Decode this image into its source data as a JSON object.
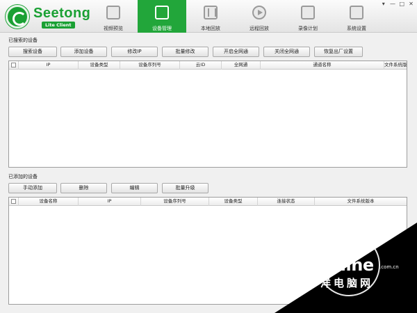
{
  "app": {
    "brand": "Seetong",
    "badge": "Lite Client",
    "window_controls": [
      "▾",
      "—",
      "□",
      "✕"
    ]
  },
  "nav": {
    "tabs": [
      {
        "label": "视频预览",
        "icon": "monitor-icon"
      },
      {
        "label": "设备管理",
        "icon": "device-monitor-icon",
        "active": true
      },
      {
        "label": "本地回放",
        "icon": "film-icon"
      },
      {
        "label": "远程回放",
        "icon": "play-circle-icon"
      },
      {
        "label": "录像计划",
        "icon": "schedule-icon"
      },
      {
        "label": "系统设置",
        "icon": "settings-screen-icon"
      }
    ]
  },
  "searched": {
    "title": "已搜索的设备",
    "buttons": [
      "搜索设备",
      "添加设备",
      "修改IP",
      "批量修改",
      "开启全网通",
      "关闭全网通",
      "恢复出厂设置"
    ],
    "columns": [
      "IP",
      "设备类型",
      "设备序列号",
      "云ID",
      "全网通",
      "通道名称",
      "文件系统版本"
    ],
    "rows": []
  },
  "added": {
    "title": "已添加的设备",
    "buttons": [
      "手动添加",
      "删除",
      "编辑",
      "批量升级"
    ],
    "columns": [
      "设备名称",
      "IP",
      "设备序列号",
      "设备类型",
      "连接状态",
      "文件系统版本"
    ],
    "rows": []
  },
  "watermark": {
    "brand": "PConline",
    "domain": ".com.cn",
    "subtitle": "太平洋电脑网"
  },
  "colors": {
    "accent": "#22a63a"
  }
}
